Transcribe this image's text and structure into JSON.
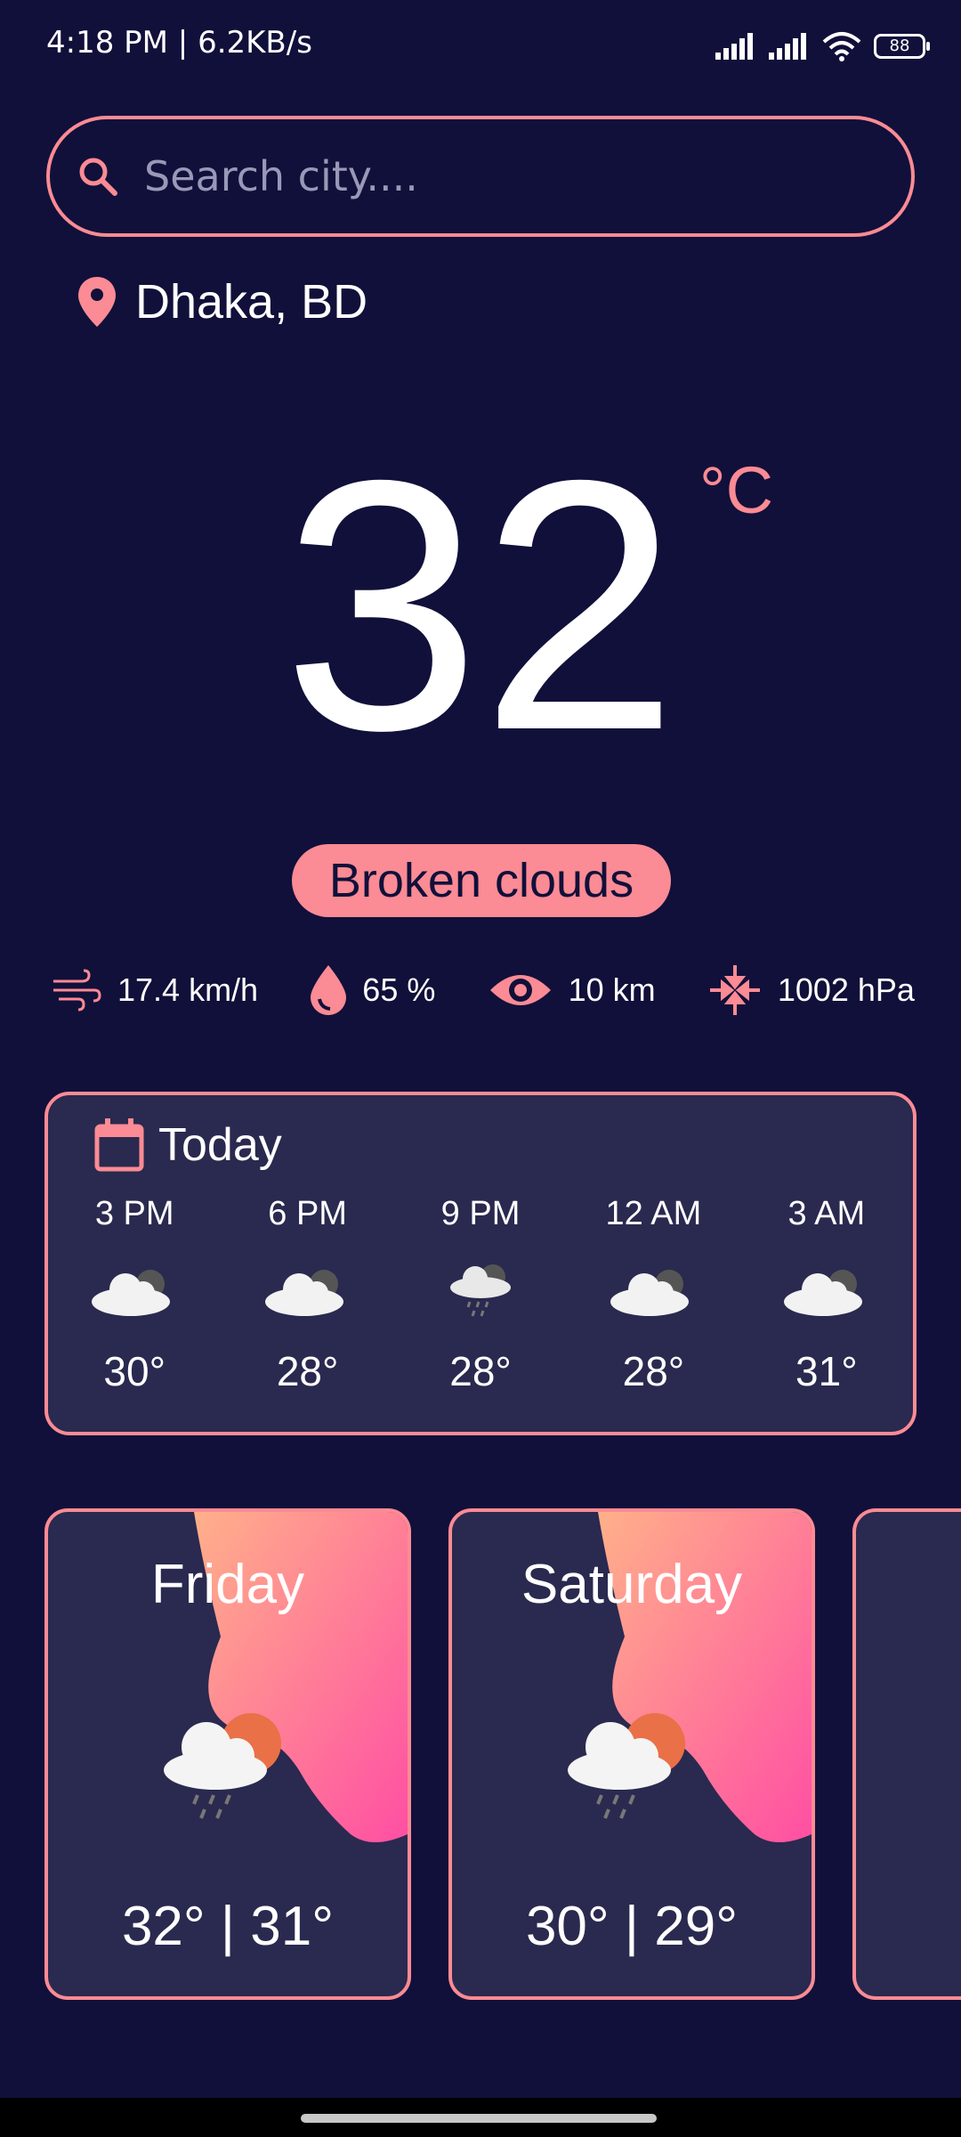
{
  "status": {
    "time": "4:18 PM | 6.2KB/s",
    "battery": "88"
  },
  "search": {
    "placeholder": "Search city...."
  },
  "location": {
    "label": "Dhaka, BD"
  },
  "current": {
    "temperature": "32",
    "unit": "°C",
    "condition": "Broken clouds"
  },
  "metrics": {
    "wind": "17.4 km/h",
    "humidity": "65 %",
    "visibility": "10 km",
    "pressure": "1002 hPa"
  },
  "today": {
    "label": "Today",
    "hours": [
      {
        "time": "3 PM",
        "icon": "cloud-sun-icon",
        "temp": "30°"
      },
      {
        "time": "6 PM",
        "icon": "cloud-sun-icon",
        "temp": "28°"
      },
      {
        "time": "9 PM",
        "icon": "cloud-rain-icon",
        "temp": "28°"
      },
      {
        "time": "12 AM",
        "icon": "cloud-sun-icon",
        "temp": "28°"
      },
      {
        "time": "3 AM",
        "icon": "cloud-sun-icon",
        "temp": "31°"
      }
    ]
  },
  "forecast": [
    {
      "day": "Friday",
      "temps": "32° | 31°",
      "icon": "sun-cloud-rain-icon"
    },
    {
      "day": "Saturday",
      "temps": "30° | 29°",
      "icon": "sun-cloud-rain-icon"
    }
  ],
  "colors": {
    "background": "#11103a",
    "accent": "#fb8b94",
    "card": "#2a294f",
    "text": "#ffffff"
  }
}
